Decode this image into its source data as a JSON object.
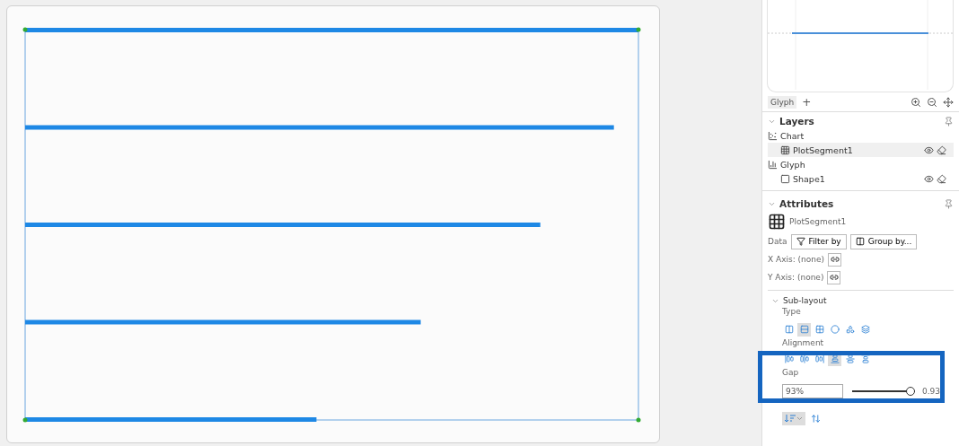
{
  "glyph_editor": {
    "tab": "Glyph",
    "add": "+"
  },
  "layers": {
    "title": "Layers",
    "items": [
      {
        "name": "Chart",
        "kind": "chart",
        "selected": false,
        "children": [
          {
            "name": "PlotSegment1",
            "kind": "grid",
            "selected": true
          }
        ]
      },
      {
        "name": "Glyph",
        "kind": "glyph",
        "selected": false,
        "children": [
          {
            "name": "Shape1",
            "kind": "shape",
            "selected": false
          }
        ]
      }
    ]
  },
  "attributes": {
    "title": "Attributes",
    "object": "PlotSegment1",
    "data_label": "Data",
    "filter": "Filter by",
    "group": "Group by...",
    "x_axis": "X Axis: (none)",
    "y_axis": "Y Axis: (none)",
    "sub_layout": {
      "title": "Sub-layout",
      "type_label": "Type",
      "types": [
        {
          "kind": "dx",
          "selected": false
        },
        {
          "kind": "dy",
          "selected": true
        },
        {
          "kind": "grid",
          "selected": false
        },
        {
          "kind": "circle",
          "selected": false
        },
        {
          "kind": "packing",
          "selected": false
        },
        {
          "kind": "overlap",
          "selected": false
        }
      ],
      "alignment_label": "Alignment",
      "alignments": [
        {
          "kind": "left",
          "selected": false
        },
        {
          "kind": "center",
          "selected": false
        },
        {
          "kind": "right",
          "selected": false
        },
        {
          "kind": "bottom",
          "selected": true
        },
        {
          "kind": "middle",
          "selected": false
        },
        {
          "kind": "top",
          "selected": false
        }
      ],
      "gap_label": "Gap",
      "gap_value": "93%",
      "gap_slider": {
        "level": 0.93
      },
      "gap_reading": "0.93"
    }
  }
}
